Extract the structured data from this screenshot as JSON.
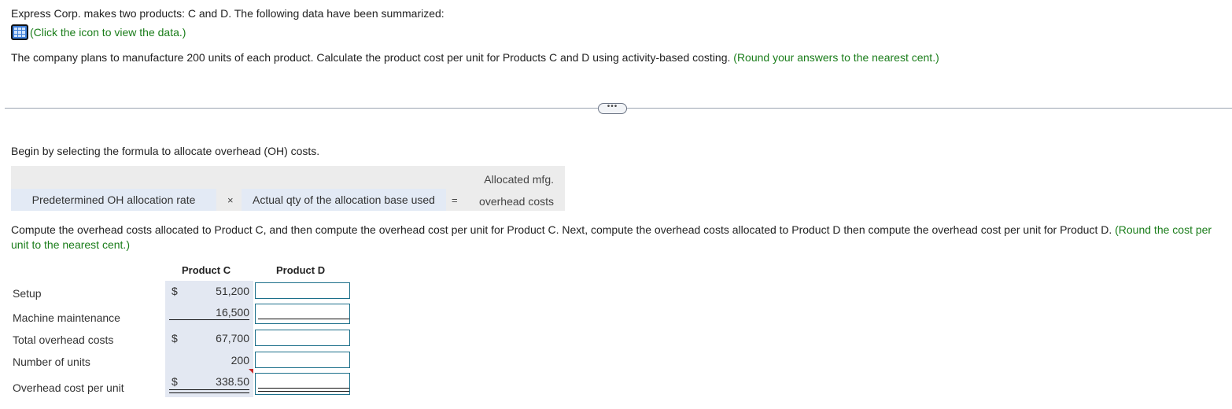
{
  "intro": "Express Corp. makes two products: C and D. The following data have been summarized:",
  "data_link": {
    "icon": "table-grid-icon",
    "label": "(Click the icon to view the data.)"
  },
  "instructions": {
    "text": "The company plans to manufacture 200 units of each product. Calculate the product cost per unit for Products C and D using activity-based costing. ",
    "hint": "(Round your answers to the nearest cent.)"
  },
  "more_button": "•••",
  "begin": "Begin by selecting the formula to allocate overhead (OH) costs.",
  "formula": {
    "term1": "Predetermined OH allocation rate",
    "op1": "×",
    "term2": "Actual qty of the allocation base used",
    "op2": "=",
    "result_line1": "Allocated mfg.",
    "result_line2": "overhead costs"
  },
  "compute": {
    "text": "Compute the overhead costs allocated to Product C, and then compute the overhead cost per unit for Product C. Next, compute the overhead costs allocated to Product D then compute the overhead cost per unit for Product D. ",
    "hint": "(Round the cost per unit to the nearest cent.)"
  },
  "table": {
    "headers": [
      "Product C",
      "Product D"
    ],
    "rows": [
      {
        "label": "Setup",
        "currency": "$",
        "product_c": "51,200",
        "product_d": ""
      },
      {
        "label": "Machine maintenance",
        "currency": "",
        "product_c": "16,500",
        "product_d": ""
      },
      {
        "label": "Total overhead costs",
        "currency": "$",
        "product_c": "67,700",
        "product_d": ""
      },
      {
        "label": "Number of units",
        "currency": "",
        "product_c": "200",
        "product_d": ""
      },
      {
        "label": "Overhead cost per unit",
        "currency": "$",
        "product_c": "338.50",
        "product_d": ""
      }
    ]
  }
}
